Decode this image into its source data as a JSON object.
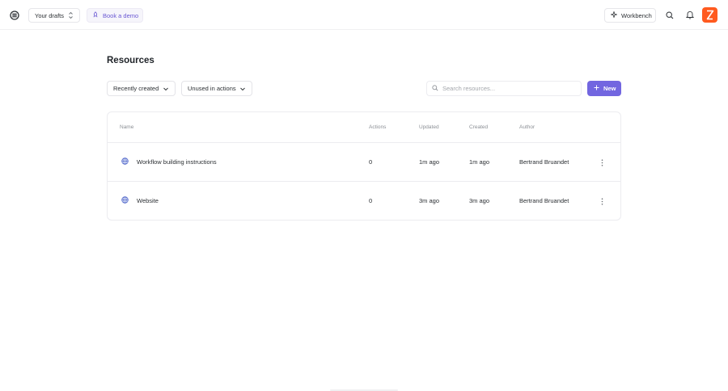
{
  "header": {
    "drafts_label": "Your drafts",
    "demo_label": "Book a demo",
    "workbench_label": "Workbench",
    "accent_color": "#7266e0",
    "logo_color": "#ff5a1f"
  },
  "main": {
    "title": "Resources",
    "filters": {
      "sort_label": "Recently created",
      "usage_label": "Unused in actions"
    },
    "search": {
      "placeholder": "Search resources..."
    },
    "new_label": "New"
  },
  "table": {
    "columns": [
      "Name",
      "Actions",
      "Updated",
      "Created",
      "Author"
    ],
    "rows": [
      {
        "name": "Workflow building instructions",
        "actions": "0",
        "updated": "1m ago",
        "created": "1m ago",
        "author": "Bertrand Bruandet",
        "icon": "globe-icon"
      },
      {
        "name": "Website",
        "actions": "0",
        "updated": "3m ago",
        "created": "3m ago",
        "author": "Bertrand Bruandet",
        "icon": "globe-icon"
      }
    ]
  }
}
